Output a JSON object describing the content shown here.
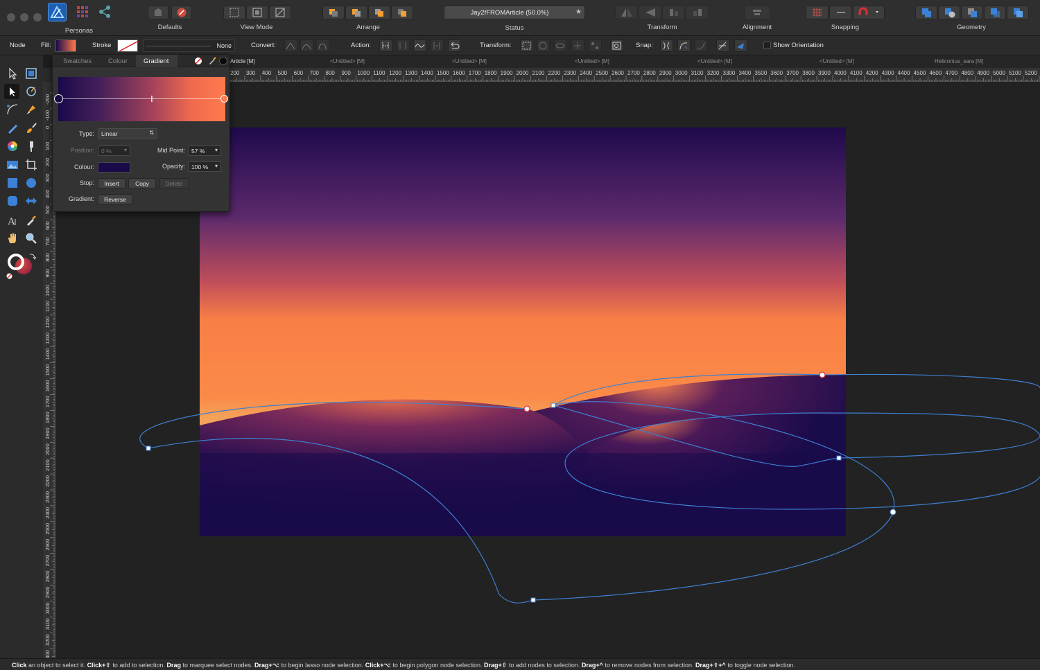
{
  "toolbar": {
    "personas_label": "Personas",
    "defaults_label": "Defaults",
    "view_mode_label": "View Mode",
    "arrange_label": "Arrange",
    "status_label": "Status",
    "document_status": "Jay2fFROMArticle (50.0%)",
    "transform_label": "Transform",
    "alignment_label": "Alignment",
    "snapping_label": "Snapping",
    "geometry_label": "Geometry"
  },
  "context_toolbar": {
    "tool_name": "Node",
    "fill_label": "Fill:",
    "stroke_label": "Stroke",
    "stroke_width_value": "None",
    "convert_label": "Convert:",
    "action_label": "Action:",
    "transform_label": "Transform:",
    "snap_label": "Snap:",
    "show_orientation_label": "Show Orientation",
    "show_orientation_checked": false
  },
  "document_tabs": [
    "Article [M]",
    "<Untitled> [M]",
    "<Untitled> [M]",
    "<Untitled> [M]",
    "<Untitled> [M]",
    "<Untitled> [M]",
    "Heliconius_sara [M]"
  ],
  "ruler_h_ticks": [
    "200",
    "300",
    "400",
    "500",
    "600",
    "700",
    "800",
    "900",
    "1000",
    "1100",
    "1200",
    "1300",
    "1400",
    "1500",
    "1600",
    "1700",
    "1800",
    "1900",
    "2000",
    "2100",
    "2200",
    "2300",
    "2400",
    "2500",
    "2600",
    "2700",
    "2800",
    "2900",
    "3000",
    "3100",
    "3200",
    "3300",
    "3400",
    "3500",
    "3600",
    "3700",
    "3800",
    "3900",
    "4000",
    "4100",
    "4200",
    "4300",
    "4400",
    "4500",
    "4600",
    "4700",
    "4800",
    "4900",
    "5000",
    "5100",
    "5200",
    "53"
  ],
  "ruler_v_ticks": [
    "-200",
    "-100",
    "0",
    "100",
    "200",
    "300",
    "400",
    "500",
    "600",
    "700",
    "800",
    "900",
    "1000",
    "1100",
    "1200",
    "1300",
    "1400",
    "1500",
    "1600",
    "1700",
    "1800",
    "1900",
    "2000",
    "2100",
    "2200",
    "2300",
    "2400",
    "2500",
    "2600",
    "2700",
    "2800",
    "2900",
    "3000",
    "3100",
    "3200",
    "3300"
  ],
  "gradient_panel": {
    "tabs": [
      "Swatches",
      "Colour",
      "Gradient"
    ],
    "active_tab": "Gradient",
    "type_label": "Type:",
    "type_value": "Linear",
    "position_label": "Position:",
    "position_value": "0 %",
    "midpoint_label": "Mid Point:",
    "midpoint_value": "57 %",
    "colour_label": "Colour:",
    "opacity_label": "Opacity:",
    "opacity_value": "100 %",
    "stop_label": "Stop:",
    "insert_label": "Insert",
    "copy_label": "Copy",
    "delete_label": "Delete",
    "gradient_label": "Gradient:",
    "reverse_label": "Reverse",
    "start_color": "#1a0a4a",
    "end_color": "#ff7a4e"
  },
  "status_bar": {
    "segments": [
      {
        "b": "Click",
        "t": " an object to select it. "
      },
      {
        "b": "Click+⇧",
        "t": " to add to selection. "
      },
      {
        "b": "Drag",
        "t": " to marquee select nodes. "
      },
      {
        "b": "Drag+⌥",
        "t": " to begin lasso node selection. "
      },
      {
        "b": "Click+⌥",
        "t": " to begin polygon node selection. "
      },
      {
        "b": "Drag+⇧",
        "t": " to add nodes to selection. "
      },
      {
        "b": "Drag+^",
        "t": " to remove nodes from selection. "
      },
      {
        "b": "Drag+⇧+^",
        "t": " to toggle node selection."
      }
    ]
  },
  "colors": {
    "accent_blue": "#3b82d6",
    "path_stroke": "#3d7fd1",
    "sky_top": "#1f0a4c",
    "sky_orange": "#f87f45",
    "dune_dark": "#1a0b4a"
  }
}
